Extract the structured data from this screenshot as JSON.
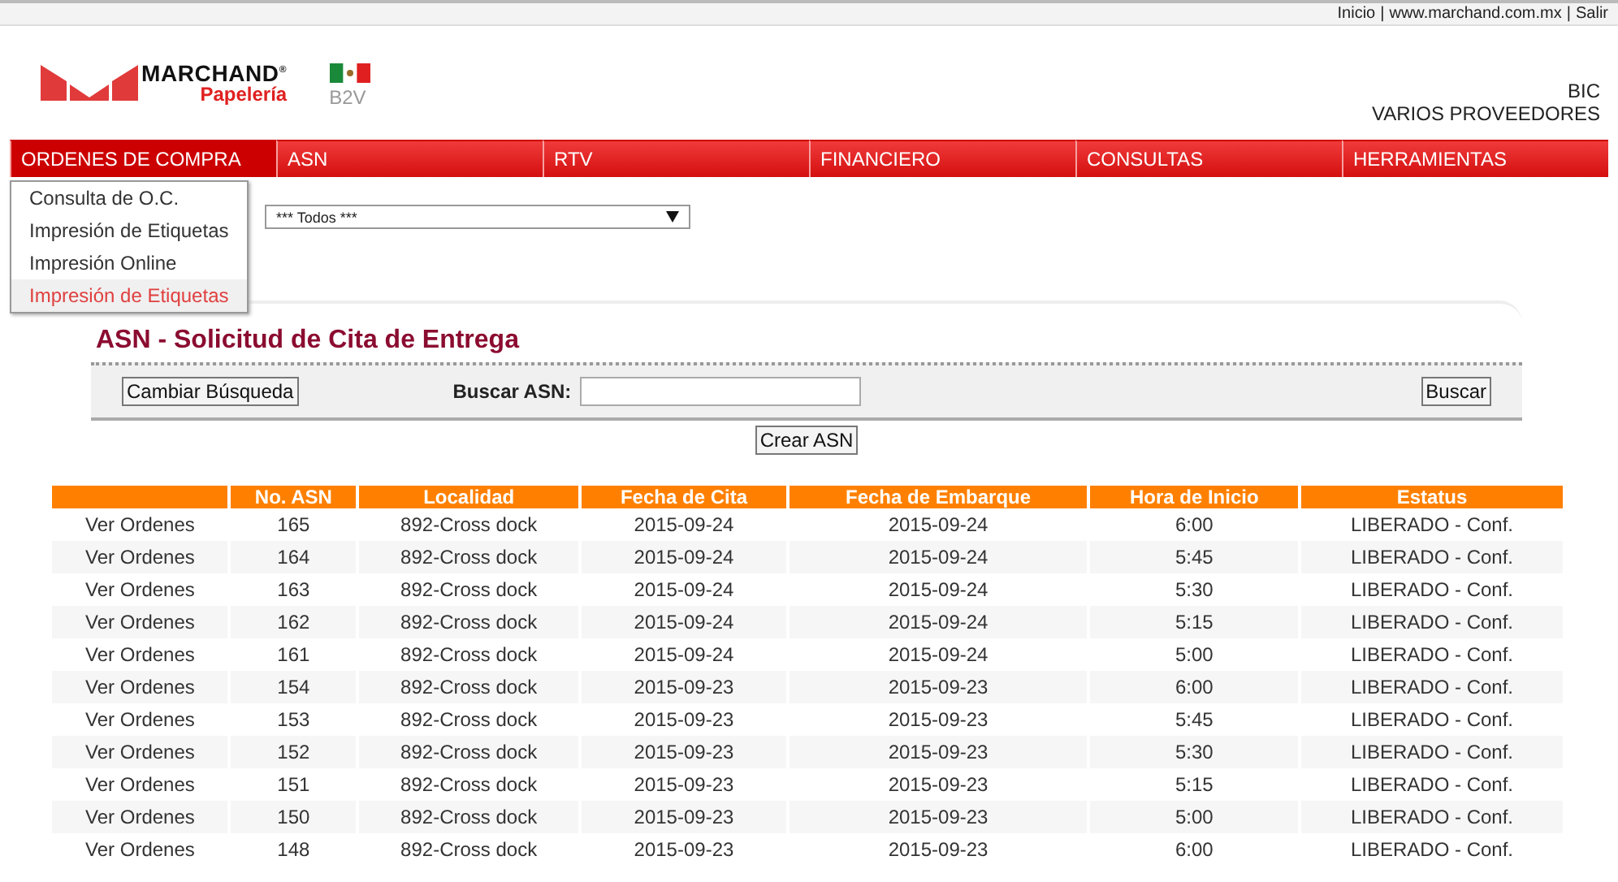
{
  "top_bar": {
    "links": [
      "Inicio",
      "www.marchand.com.mx",
      "Salir"
    ],
    "separator": "|"
  },
  "header": {
    "brand": "MARCHAND",
    "brand_mark": "®",
    "subbrand": "Papelería",
    "system": "B2V",
    "account_lines": [
      "BIC",
      "VARIOS PROVEEDORES"
    ]
  },
  "nav": [
    {
      "label": "ORDENES DE COMPRA",
      "selected": true
    },
    {
      "label": "ASN",
      "selected": false
    },
    {
      "label": "RTV",
      "selected": false
    },
    {
      "label": "FINANCIERO",
      "selected": false
    },
    {
      "label": "CONSULTAS",
      "selected": false
    },
    {
      "label": "HERRAMIENTAS",
      "selected": false
    }
  ],
  "nav_menu": [
    {
      "label": "Consulta de O.C.",
      "selected": false
    },
    {
      "label": "Impresión de Etiquetas",
      "selected": false
    },
    {
      "label": "Impresión Online",
      "selected": false
    },
    {
      "label": "Impresión de Etiquetas",
      "selected": true
    }
  ],
  "provider_select": {
    "value": "*** Todos ***"
  },
  "panel": {
    "title": "ASN - Solicitud de Cita de Entrega",
    "change_button": "Cambiar Búsqueda",
    "search_label": "Buscar ASN:",
    "search_button": "Buscar",
    "create_button": "Crear ASN"
  },
  "table": {
    "columns": [
      "No. ASN",
      "Localidad",
      "Fecha de Cita",
      "Fecha de Embarque",
      "Hora de Inicio",
      "Estatus"
    ],
    "rows": [
      {
        "link": "Ver Ordenes",
        "cells": [
          "165",
          "892-Cross dock",
          "2015-09-24",
          "2015-09-24",
          "6:00",
          "LIBERADO - Conf."
        ]
      },
      {
        "link": "Ver Ordenes",
        "cells": [
          "164",
          "892-Cross dock",
          "2015-09-24",
          "2015-09-24",
          "5:45",
          "LIBERADO - Conf."
        ]
      },
      {
        "link": "Ver Ordenes",
        "cells": [
          "163",
          "892-Cross dock",
          "2015-09-24",
          "2015-09-24",
          "5:30",
          "LIBERADO - Conf."
        ]
      },
      {
        "link": "Ver Ordenes",
        "cells": [
          "162",
          "892-Cross dock",
          "2015-09-24",
          "2015-09-24",
          "5:15",
          "LIBERADO - Conf."
        ]
      },
      {
        "link": "Ver Ordenes",
        "cells": [
          "161",
          "892-Cross dock",
          "2015-09-24",
          "2015-09-24",
          "5:00",
          "LIBERADO - Conf."
        ]
      },
      {
        "link": "Ver Ordenes",
        "cells": [
          "154",
          "892-Cross dock",
          "2015-09-23",
          "2015-09-23",
          "6:00",
          "LIBERADO - Conf."
        ]
      },
      {
        "link": "Ver Ordenes",
        "cells": [
          "153",
          "892-Cross dock",
          "2015-09-23",
          "2015-09-23",
          "5:45",
          "LIBERADO - Conf."
        ]
      },
      {
        "link": "Ver Ordenes",
        "cells": [
          "152",
          "892-Cross dock",
          "2015-09-23",
          "2015-09-23",
          "5:30",
          "LIBERADO - Conf."
        ]
      },
      {
        "link": "Ver Ordenes",
        "cells": [
          "151",
          "892-Cross dock",
          "2015-09-23",
          "2015-09-23",
          "5:15",
          "LIBERADO - Conf."
        ]
      },
      {
        "link": "Ver Ordenes",
        "cells": [
          "150",
          "892-Cross dock",
          "2015-09-23",
          "2015-09-23",
          "5:00",
          "LIBERADO - Conf."
        ]
      },
      {
        "link": "Ver Ordenes",
        "cells": [
          "148",
          "892-Cross dock",
          "2015-09-23",
          "2015-09-23",
          "6:00",
          "LIBERADO - Conf."
        ]
      }
    ]
  }
}
